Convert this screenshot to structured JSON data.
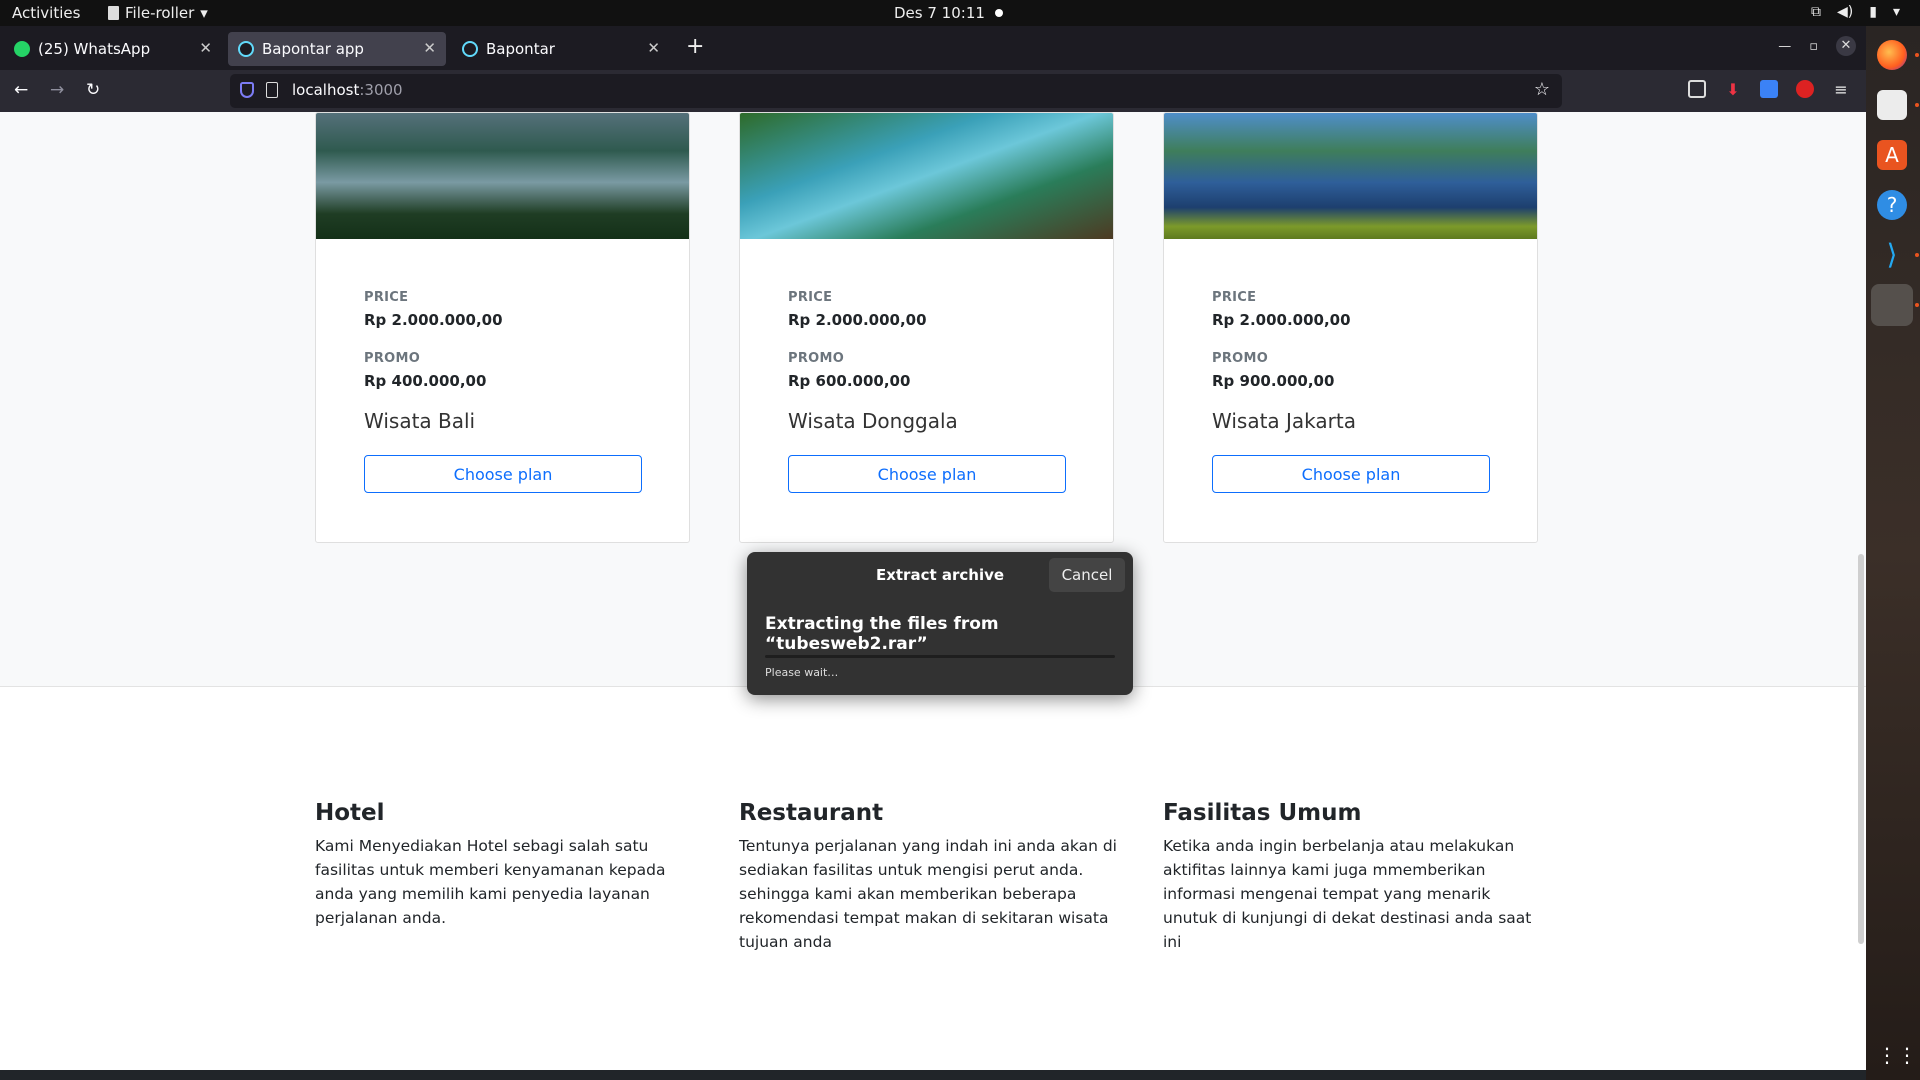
{
  "system": {
    "activities": "Activities",
    "app_menu": "File-roller",
    "datetime": "Des 7  10:11"
  },
  "browser": {
    "tabs": [
      {
        "label": "(25) WhatsApp",
        "active": false,
        "icon": "whatsapp-icon"
      },
      {
        "label": "Bapontar app",
        "active": true,
        "icon": "react-icon"
      },
      {
        "label": "Bapontar",
        "active": false,
        "icon": "react-icon"
      }
    ],
    "url_host": "localhost",
    "url_port": ":3000"
  },
  "cards": [
    {
      "price_label": "PRICE",
      "price": "Rp 2.000.000,00",
      "promo_label": "PROMO",
      "promo": "Rp 400.000,00",
      "title": "Wisata Bali",
      "button": "Choose plan"
    },
    {
      "price_label": "PRICE",
      "price": "Rp 2.000.000,00",
      "promo_label": "PROMO",
      "promo": "Rp 600.000,00",
      "title": "Wisata Donggala",
      "button": "Choose plan"
    },
    {
      "price_label": "PRICE",
      "price": "Rp 2.000.000,00",
      "promo_label": "PROMO",
      "promo": "Rp 900.000,00",
      "title": "Wisata Jakarta",
      "button": "Choose plan"
    }
  ],
  "features": [
    {
      "title": "Hotel",
      "text": "Kami Menyediakan Hotel sebagi salah satu fasilitas untuk memberi kenyamanan kepada anda yang memilih kami penyedia layanan perjalanan anda."
    },
    {
      "title": "Restaurant",
      "text": "Tentunya perjalanan yang indah ini anda akan di sediakan fasilitas untuk mengisi perut anda. sehingga kami akan memberikan beberapa rekomendasi tempat makan di sekitaran wisata tujuan anda"
    },
    {
      "title": "Fasilitas Umum",
      "text": "Ketika anda ingin berbelanja atau melakukan aktifitas lainnya kami juga mmemberikan informasi mengenai tempat yang menarik unutuk di kunjungi di dekat destinasi anda saat ini"
    }
  ],
  "dialog": {
    "title": "Extract archive",
    "cancel": "Cancel",
    "message": "Extracting the files from “tubesweb2.rar”",
    "status": "Please wait…",
    "progress": 0
  },
  "colors": {
    "accent": "#0d6efd",
    "dialog_bg": "#323232",
    "topbar": "#111111"
  }
}
